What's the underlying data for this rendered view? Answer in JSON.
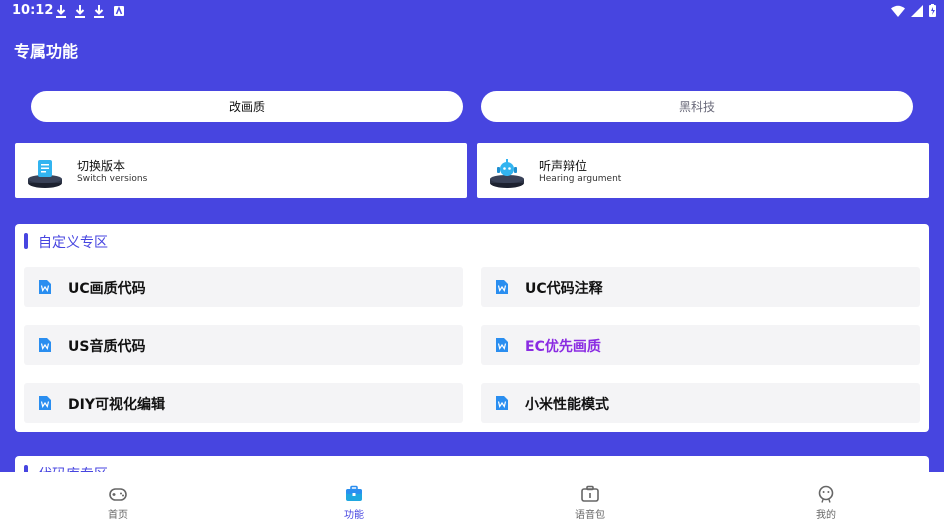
{
  "status": {
    "time": "10:12"
  },
  "page_title": "专属功能",
  "tabs": [
    {
      "label": "改画质",
      "selected": true
    },
    {
      "label": "黑科技",
      "selected": false
    }
  ],
  "cards": [
    {
      "title": "切换版本",
      "subtitle": "Switch versions",
      "icon": "document-pedestal-icon"
    },
    {
      "title": "听声辩位",
      "subtitle": "Hearing argument",
      "icon": "robot-pedestal-icon"
    }
  ],
  "custom_section": {
    "title": "自定义专区",
    "items": [
      {
        "label": "UC画质代码"
      },
      {
        "label": "UC代码注释"
      },
      {
        "label": "US音质代码"
      },
      {
        "label": "EC优先画质",
        "highlight": "#8a2be2"
      },
      {
        "label": "DIY可视化编辑"
      },
      {
        "label": "小米性能模式"
      }
    ]
  },
  "code_section": {
    "title": "代码库专区"
  },
  "bottom_nav": [
    {
      "label": "首页",
      "icon": "gamepad-icon"
    },
    {
      "label": "功能",
      "icon": "briefcase-icon",
      "active": true
    },
    {
      "label": "语音包",
      "icon": "package-icon"
    },
    {
      "label": "我的",
      "icon": "smiley-icon"
    }
  ],
  "colors": {
    "primary": "#4745e0",
    "accent": "#8a2be2"
  }
}
